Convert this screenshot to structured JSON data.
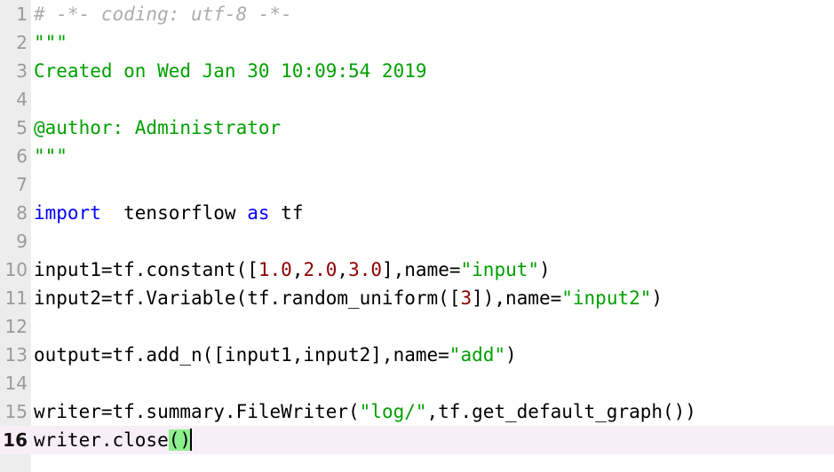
{
  "editor": {
    "language": "python",
    "total_lines": 16,
    "current_line": 16,
    "colors": {
      "background": "#ffffff",
      "gutter_background": "#ededed",
      "gutter_text": "#9a9a9a",
      "current_line_highlight": "#f8eef8",
      "comment": "#adadad",
      "string": "#00a000",
      "keyword": "#0000ff",
      "number": "#8b0000",
      "plain_text": "#000000",
      "bracket_match": "#8cf08c",
      "caret": "#000000"
    },
    "lines": [
      {
        "n": "1",
        "tokens": [
          {
            "t": "# -*- coding: utf-8 -*-",
            "c": "comment"
          }
        ]
      },
      {
        "n": "2",
        "tokens": [
          {
            "t": "\"\"\"",
            "c": "string"
          }
        ]
      },
      {
        "n": "3",
        "tokens": [
          {
            "t": "Created on Wed Jan 30 10:09:54 2019",
            "c": "string"
          }
        ]
      },
      {
        "n": "4",
        "tokens": []
      },
      {
        "n": "5",
        "tokens": [
          {
            "t": "@author: Administrator",
            "c": "string"
          }
        ]
      },
      {
        "n": "6",
        "tokens": [
          {
            "t": "\"\"\"",
            "c": "string"
          }
        ]
      },
      {
        "n": "7",
        "tokens": []
      },
      {
        "n": "8",
        "tokens": [
          {
            "t": "import",
            "c": "kw"
          },
          {
            "t": "  tensorflow ",
            "c": "plain"
          },
          {
            "t": "as",
            "c": "kw"
          },
          {
            "t": " tf",
            "c": "plain"
          }
        ]
      },
      {
        "n": "9",
        "tokens": []
      },
      {
        "n": "10",
        "tokens": [
          {
            "t": "input1=tf.constant([",
            "c": "plain"
          },
          {
            "t": "1.0",
            "c": "num"
          },
          {
            "t": ",",
            "c": "plain"
          },
          {
            "t": "2.0",
            "c": "num"
          },
          {
            "t": ",",
            "c": "plain"
          },
          {
            "t": "3.0",
            "c": "num"
          },
          {
            "t": "],name=",
            "c": "plain"
          },
          {
            "t": "\"input\"",
            "c": "string"
          },
          {
            "t": ")",
            "c": "plain"
          }
        ]
      },
      {
        "n": "11",
        "tokens": [
          {
            "t": "input2=tf.Variable(tf.random_uniform([",
            "c": "plain"
          },
          {
            "t": "3",
            "c": "num"
          },
          {
            "t": "]),name=",
            "c": "plain"
          },
          {
            "t": "\"input2\"",
            "c": "string"
          },
          {
            "t": ")",
            "c": "plain"
          }
        ]
      },
      {
        "n": "12",
        "tokens": []
      },
      {
        "n": "13",
        "tokens": [
          {
            "t": "output=tf.add_n([input1,input2],name=",
            "c": "plain"
          },
          {
            "t": "\"add\"",
            "c": "string"
          },
          {
            "t": ")",
            "c": "plain"
          }
        ]
      },
      {
        "n": "14",
        "tokens": []
      },
      {
        "n": "15",
        "tokens": [
          {
            "t": "writer=tf.summary.FileWriter(",
            "c": "plain"
          },
          {
            "t": "\"log/\"",
            "c": "string"
          },
          {
            "t": ",tf.get_default_graph())",
            "c": "plain"
          }
        ]
      },
      {
        "n": "16",
        "current": true,
        "caret_after": true,
        "tokens": [
          {
            "t": "writer.close",
            "c": "plain"
          },
          {
            "t": "()",
            "c": "plain",
            "match": true
          }
        ]
      }
    ]
  }
}
